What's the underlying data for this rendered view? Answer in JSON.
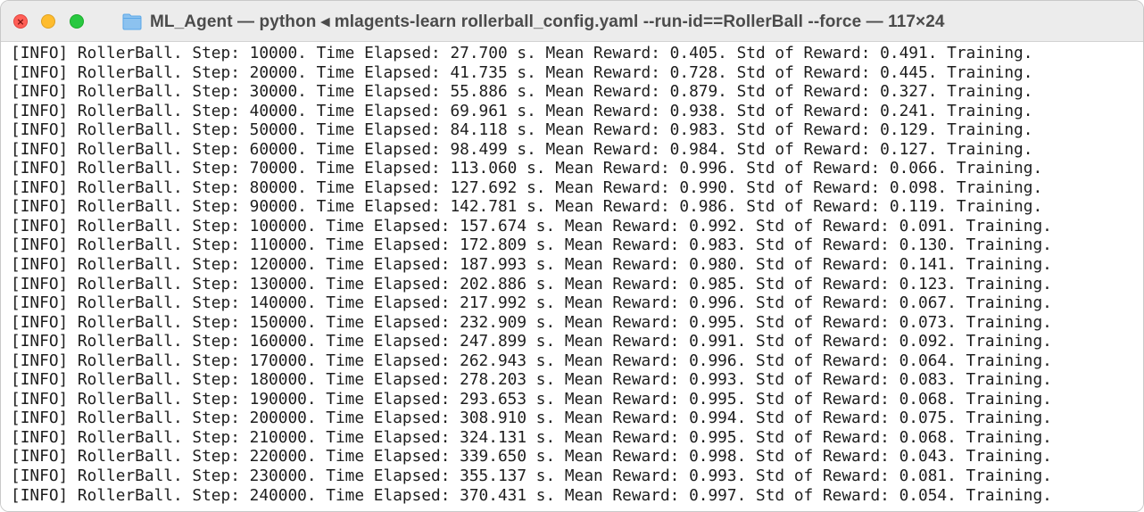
{
  "window": {
    "title": "ML_Agent — python ◂ mlagents-learn rollerball_config.yaml --run-id==RollerBall --force — 117×24",
    "close_glyph": "×",
    "accent_colors": {
      "close": "#ff5f57",
      "minimize": "#febc2e",
      "zoom": "#28c840",
      "folder": "#5aa7e8"
    },
    "icons": [
      "close-icon",
      "minimize-icon",
      "zoom-icon",
      "folder-icon"
    ]
  },
  "terminal": {
    "lines": [
      "[INFO] RollerBall. Step: 10000. Time Elapsed: 27.700 s. Mean Reward: 0.405. Std of Reward: 0.491. Training.",
      "[INFO] RollerBall. Step: 20000. Time Elapsed: 41.735 s. Mean Reward: 0.728. Std of Reward: 0.445. Training.",
      "[INFO] RollerBall. Step: 30000. Time Elapsed: 55.886 s. Mean Reward: 0.879. Std of Reward: 0.327. Training.",
      "[INFO] RollerBall. Step: 40000. Time Elapsed: 69.961 s. Mean Reward: 0.938. Std of Reward: 0.241. Training.",
      "[INFO] RollerBall. Step: 50000. Time Elapsed: 84.118 s. Mean Reward: 0.983. Std of Reward: 0.129. Training.",
      "[INFO] RollerBall. Step: 60000. Time Elapsed: 98.499 s. Mean Reward: 0.984. Std of Reward: 0.127. Training.",
      "[INFO] RollerBall. Step: 70000. Time Elapsed: 113.060 s. Mean Reward: 0.996. Std of Reward: 0.066. Training.",
      "[INFO] RollerBall. Step: 80000. Time Elapsed: 127.692 s. Mean Reward: 0.990. Std of Reward: 0.098. Training.",
      "[INFO] RollerBall. Step: 90000. Time Elapsed: 142.781 s. Mean Reward: 0.986. Std of Reward: 0.119. Training.",
      "[INFO] RollerBall. Step: 100000. Time Elapsed: 157.674 s. Mean Reward: 0.992. Std of Reward: 0.091. Training.",
      "[INFO] RollerBall. Step: 110000. Time Elapsed: 172.809 s. Mean Reward: 0.983. Std of Reward: 0.130. Training.",
      "[INFO] RollerBall. Step: 120000. Time Elapsed: 187.993 s. Mean Reward: 0.980. Std of Reward: 0.141. Training.",
      "[INFO] RollerBall. Step: 130000. Time Elapsed: 202.886 s. Mean Reward: 0.985. Std of Reward: 0.123. Training.",
      "[INFO] RollerBall. Step: 140000. Time Elapsed: 217.992 s. Mean Reward: 0.996. Std of Reward: 0.067. Training.",
      "[INFO] RollerBall. Step: 150000. Time Elapsed: 232.909 s. Mean Reward: 0.995. Std of Reward: 0.073. Training.",
      "[INFO] RollerBall. Step: 160000. Time Elapsed: 247.899 s. Mean Reward: 0.991. Std of Reward: 0.092. Training.",
      "[INFO] RollerBall. Step: 170000. Time Elapsed: 262.943 s. Mean Reward: 0.996. Std of Reward: 0.064. Training.",
      "[INFO] RollerBall. Step: 180000. Time Elapsed: 278.203 s. Mean Reward: 0.993. Std of Reward: 0.083. Training.",
      "[INFO] RollerBall. Step: 190000. Time Elapsed: 293.653 s. Mean Reward: 0.995. Std of Reward: 0.068. Training.",
      "[INFO] RollerBall. Step: 200000. Time Elapsed: 308.910 s. Mean Reward: 0.994. Std of Reward: 0.075. Training.",
      "[INFO] RollerBall. Step: 210000. Time Elapsed: 324.131 s. Mean Reward: 0.995. Std of Reward: 0.068. Training.",
      "[INFO] RollerBall. Step: 220000. Time Elapsed: 339.650 s. Mean Reward: 0.998. Std of Reward: 0.043. Training.",
      "[INFO] RollerBall. Step: 230000. Time Elapsed: 355.137 s. Mean Reward: 0.993. Std of Reward: 0.081. Training.",
      "[INFO] RollerBall. Step: 240000. Time Elapsed: 370.431 s. Mean Reward: 0.997. Std of Reward: 0.054. Training."
    ]
  }
}
